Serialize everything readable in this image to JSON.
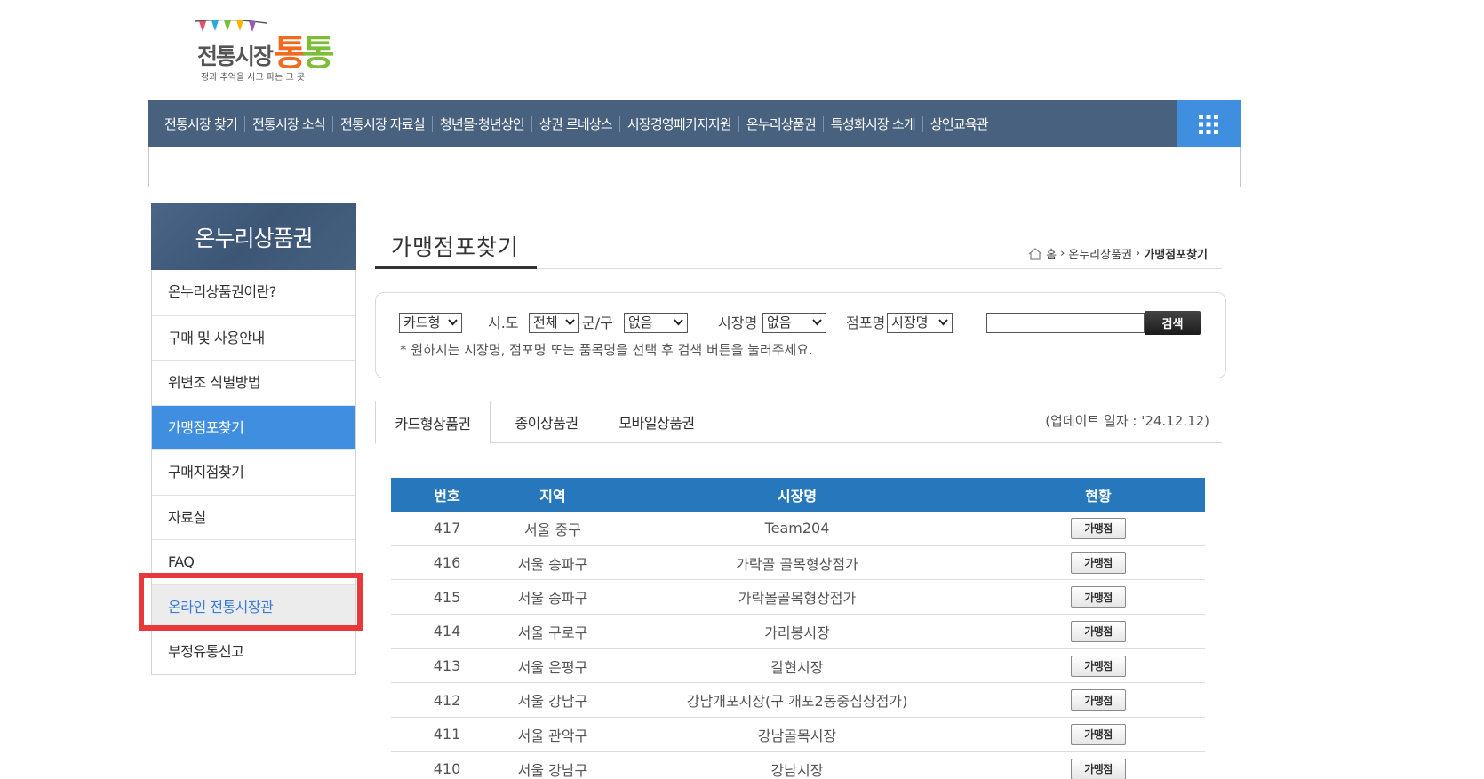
{
  "logo": {
    "main": "전통시장",
    "tong1": "통",
    "tong2": "통",
    "sub": "정과 추억을 사고 파는 그 곳"
  },
  "topnav": {
    "items": [
      "전통시장 찾기",
      "전통시장 소식",
      "전통시장 자료실",
      "청년몰·청년상인",
      "상권 르네상스",
      "시장경영패키지지원",
      "온누리상품권",
      "특성화시장 소개",
      "상인교육관"
    ]
  },
  "sidebar": {
    "title": "온누리상품권",
    "items": [
      {
        "label": "온누리상품권이란?"
      },
      {
        "label": "구매 및 사용안내"
      },
      {
        "label": "위변조 식별방법"
      },
      {
        "label": "가맹점포찾기"
      },
      {
        "label": "구매지점찾기"
      },
      {
        "label": "자료실"
      },
      {
        "label": "FAQ"
      },
      {
        "label": "온라인 전통시장관"
      },
      {
        "label": "부정유통신고"
      }
    ]
  },
  "page": {
    "title": "가맹점포찾기",
    "breadcrumb": {
      "home": "홈",
      "section": "온누리상품권",
      "current": "가맹점포찾기"
    }
  },
  "search": {
    "type_value": "카드형",
    "sido_label": "시.도",
    "sido_value": "전체",
    "gugun_label": "군/구",
    "gugun_value": "없음",
    "market_label": "시장명",
    "market_value": "없음",
    "store_label": "점포명",
    "store_value": "시장명",
    "input_value": "",
    "button": "검색",
    "hint": "* 원하시는 시장명, 점포명 또는 품목명을 선택 후 검색 버튼을 눌러주세요."
  },
  "tabs": [
    "카드형상품권",
    "종이상품권",
    "모바일상품권"
  ],
  "update_date": "(업데이트 일자 : '24.12.12)",
  "table": {
    "headers": [
      "번호",
      "지역",
      "시장명",
      "현황"
    ],
    "button_label": "가맹점",
    "rows": [
      {
        "no": "417",
        "region": "서울 중구",
        "market": "Team204"
      },
      {
        "no": "416",
        "region": "서울 송파구",
        "market": "가락골 골목형상점가"
      },
      {
        "no": "415",
        "region": "서울 송파구",
        "market": "가락몰골목형상점가"
      },
      {
        "no": "414",
        "region": "서울 구로구",
        "market": "가리봉시장"
      },
      {
        "no": "413",
        "region": "서울 은평구",
        "market": "갈현시장"
      },
      {
        "no": "412",
        "region": "서울 강남구",
        "market": "강남개포시장(구 개포2동중심상점가)"
      },
      {
        "no": "411",
        "region": "서울 관악구",
        "market": "강남골목시장"
      },
      {
        "no": "410",
        "region": "서울 강남구",
        "market": "강남시장"
      }
    ]
  },
  "colors": {
    "nav_bg": "#48617f",
    "accent_blue": "#3f8edf",
    "table_header": "#2677bb",
    "highlight_red": "#e8383b"
  }
}
